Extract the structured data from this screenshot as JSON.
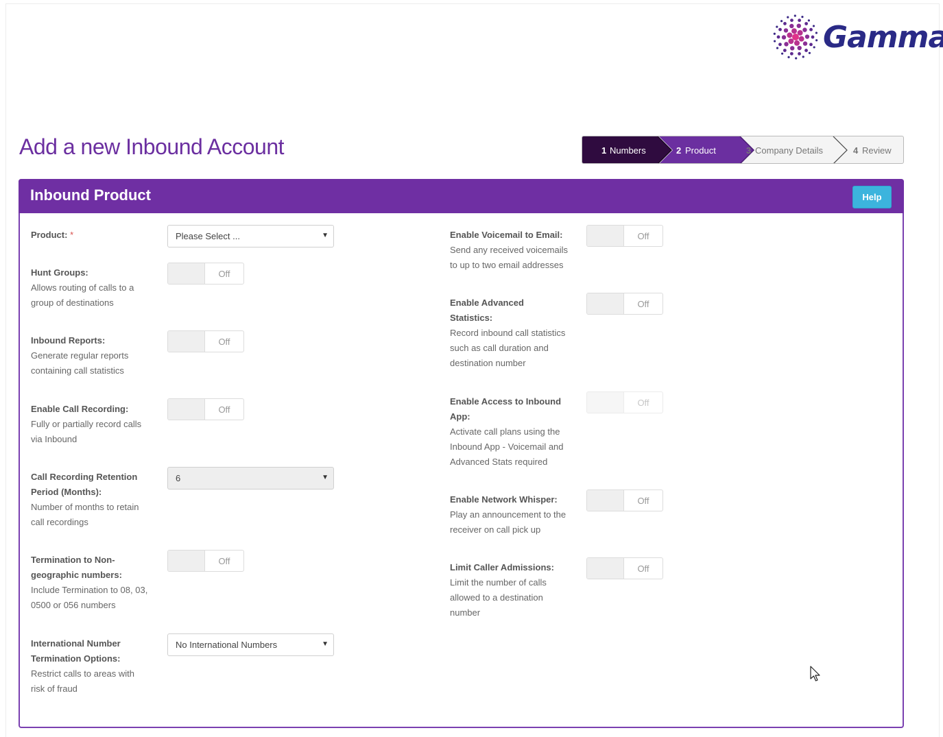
{
  "brand": {
    "logo_text": "Gamma",
    "accent": "#6f2fa3",
    "dark": "#2f0b3f",
    "help_color": "#3cb4dd"
  },
  "page_title": "Add a new Inbound Account",
  "wizard": [
    {
      "num": "1",
      "label": "Numbers"
    },
    {
      "num": "2",
      "label": "Product"
    },
    {
      "num": "3",
      "label": "Company Details"
    },
    {
      "num": "4",
      "label": "Review"
    }
  ],
  "panel": {
    "title": "Inbound Product",
    "help_label": "Help"
  },
  "left_fields": {
    "product": {
      "label": "Product:",
      "required": "*",
      "value": "Please Select ..."
    },
    "hunt_groups": {
      "label": "Hunt Groups:",
      "desc1": "Allows routing of calls to a",
      "desc2": "group of destinations",
      "state": "Off"
    },
    "inbound_reports": {
      "label": "Inbound Reports:",
      "desc1": "Generate regular reports",
      "desc2": "containing call statistics",
      "state": "Off"
    },
    "call_recording": {
      "label": "Enable Call Recording:",
      "desc1": "Fully or partially record calls",
      "desc2": "via Inbound",
      "state": "Off"
    },
    "retention": {
      "label1": "Call Recording Retention",
      "label2": "Period (Months):",
      "desc1": "Number of months to retain",
      "desc2": "call recordings",
      "value": "6"
    },
    "termination": {
      "label1": "Termination to Non-",
      "label2": "geographic numbers:",
      "desc1": "Include Termination to 08, 03,",
      "desc2": "0500 or 056 numbers",
      "state": "Off"
    },
    "international": {
      "label1": "International Number",
      "label2": "Termination Options:",
      "desc1": "Restrict calls to areas with",
      "desc2": "risk of fraud",
      "value": "No International Numbers"
    }
  },
  "right_fields": {
    "voicemail": {
      "label": "Enable Voicemail to Email:",
      "desc1": "Send any received voicemails",
      "desc2": "to up to two email addresses",
      "state": "Off"
    },
    "adv_stats": {
      "label1": "Enable Advanced",
      "label2": "Statistics:",
      "desc1": "Record inbound call statistics",
      "desc2": "such as call duration and",
      "desc3": "destination number",
      "state": "Off"
    },
    "inbound_app": {
      "label1": "Enable Access to Inbound",
      "label2": "App:",
      "desc1": "Activate call plans using the",
      "desc2": "Inbound App - Voicemail and",
      "desc3": "Advanced Stats required",
      "state": "Off"
    },
    "network_whisper": {
      "label": "Enable Network Whisper:",
      "desc1": "Play an announcement to the",
      "desc2": "receiver on call pick up",
      "state": "Off"
    },
    "limit_caller": {
      "label": "Limit Caller Admissions:",
      "desc1": "Limit the number of calls",
      "desc2": "allowed to a destination",
      "desc3": "number",
      "state": "Off"
    }
  }
}
